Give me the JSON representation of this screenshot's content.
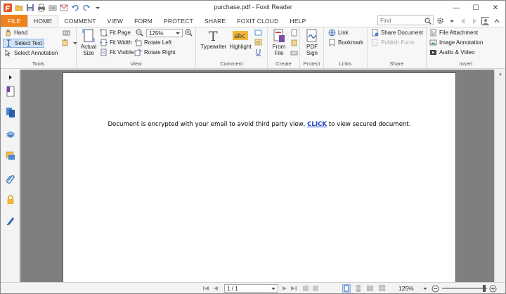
{
  "window": {
    "title": "purchase.pdf - Foxit Reader",
    "controls": [
      "—",
      "☐",
      "✕"
    ]
  },
  "tabs": [
    {
      "label": "FILE"
    },
    {
      "label": "HOME"
    },
    {
      "label": "COMMENT"
    },
    {
      "label": "VIEW"
    },
    {
      "label": "FORM"
    },
    {
      "label": "PROTECT"
    },
    {
      "label": "SHARE"
    },
    {
      "label": "FOXIT CLOUD"
    },
    {
      "label": "HELP"
    }
  ],
  "search": {
    "placeholder": "Find"
  },
  "ribbon": {
    "tools": {
      "label": "Tools",
      "hand": "Hand",
      "select_text": "Select Text",
      "select_annotation": "Select Annotation"
    },
    "view": {
      "label": "View",
      "actual_size": "Actual Size",
      "fit_page": "Fit Page",
      "fit_width": "Fit Width",
      "fit_visible": "Fit Visible",
      "zoom": "125%",
      "rotate_left": "Rotate Left",
      "rotate_right": "Rotate Right"
    },
    "comment": {
      "label": "Comment",
      "typewriter": "Typewriter",
      "highlight": "Highlight",
      "highlight_glyph": "abc"
    },
    "create": {
      "label": "Create",
      "from_file": "From File"
    },
    "protect": {
      "label": "Protect",
      "pdf_sign": "PDF Sign"
    },
    "links": {
      "label": "Links",
      "link": "Link",
      "bookmark": "Bookmark"
    },
    "share": {
      "label": "Share",
      "share_document": "Share Document",
      "publish_form": "Publish Form"
    },
    "insert": {
      "label": "Insert",
      "file_attachment": "File Attachment",
      "image_annotation": "Image Annotation",
      "audio_video": "Audio & Video"
    }
  },
  "document": {
    "text_before": "Document is encrypted with your email to avoid third party view, ",
    "link_text": "CLICK",
    "text_after": " to view secured document."
  },
  "status": {
    "page": "1 / 1",
    "zoom": "125%"
  },
  "colors": {
    "file_tab": "#f0821e",
    "page_bg": "#7f7f7f",
    "link": "#1a3fbf"
  }
}
